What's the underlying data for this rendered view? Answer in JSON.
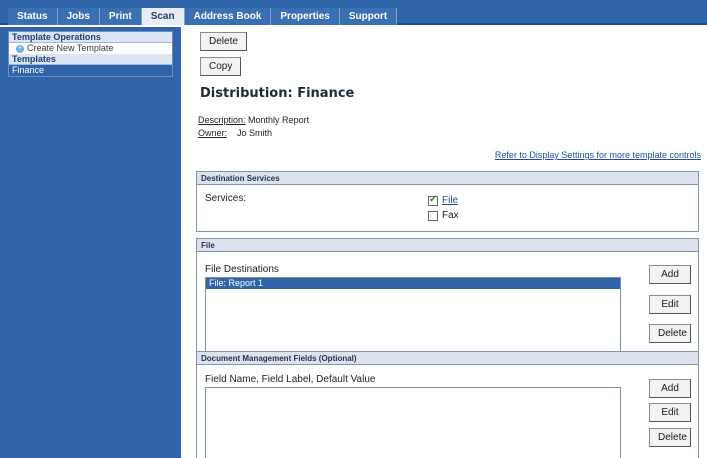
{
  "nav": {
    "tabs": [
      "Status",
      "Jobs",
      "Print",
      "Scan",
      "Address Book",
      "Properties",
      "Support"
    ],
    "active": "Scan"
  },
  "sidebar": {
    "operations_header": "Template Operations",
    "create_link": "Create New Template",
    "templates_header": "Templates",
    "templates": [
      "Finance"
    ]
  },
  "main": {
    "delete_label": "Delete",
    "copy_label": "Copy",
    "title": "Distribution: Finance",
    "description_label": "Description:",
    "description_value": "Monthly Report",
    "owner_label": "Owner:",
    "owner_value": "Jo Smith",
    "refer_link": "Refer to Display Settings for more template controls"
  },
  "destination": {
    "header": "Destination Services",
    "services_label": "Services:",
    "options": [
      {
        "label": "File",
        "checked": true
      },
      {
        "label": "Fax",
        "checked": false
      }
    ]
  },
  "file_section": {
    "header": "File",
    "list_label": "File Destinations",
    "items": [
      "File: Report 1"
    ],
    "add_label": "Add",
    "edit_label": "Edit",
    "delete_label": "Delete"
  },
  "dmf_section": {
    "header": "Document Management Fields (Optional)",
    "list_label": "Field Name, Field Label, Default Value",
    "add_label": "Add",
    "edit_label": "Edit",
    "delete_label": "Delete"
  },
  "colors": {
    "nav_blue": "#2f64a8",
    "selection_blue": "#2f64a8",
    "link_blue": "#1f4fa8"
  }
}
